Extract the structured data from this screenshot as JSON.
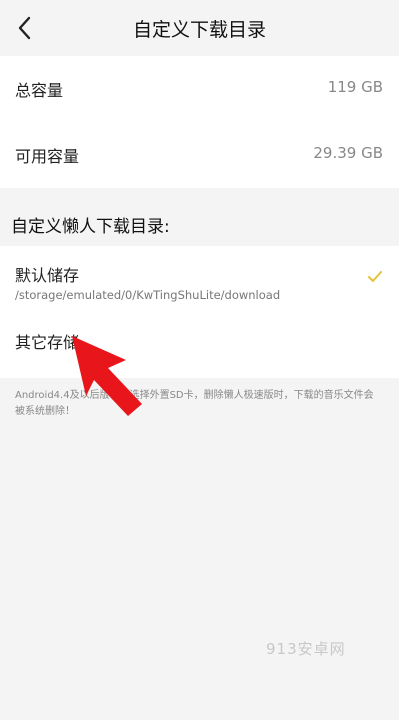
{
  "header": {
    "title": "自定义下载目录",
    "back_icon": "back-chevron-icon"
  },
  "capacity": {
    "total_label": "总容量",
    "total_value": "119 GB",
    "available_label": "可用容量",
    "available_value": "29.39 GB"
  },
  "section": {
    "title": "自定义懒人下载目录:"
  },
  "storage_options": {
    "default_label": "默认储存",
    "default_path": "/storage/emulated/0/KwTingShuLite/download",
    "default_selected_icon": "checkmark-icon",
    "other_label": "其它存储"
  },
  "note": "Android4.4及以后版本，选择外置SD卡，删除懒人极速版时，下载的音乐文件会被系统删除！",
  "watermark": "913安卓网",
  "colors": {
    "background": "#f4f4f4",
    "card": "#ffffff",
    "check": "#e8c13a",
    "annotation_arrow": "#e8161b"
  }
}
